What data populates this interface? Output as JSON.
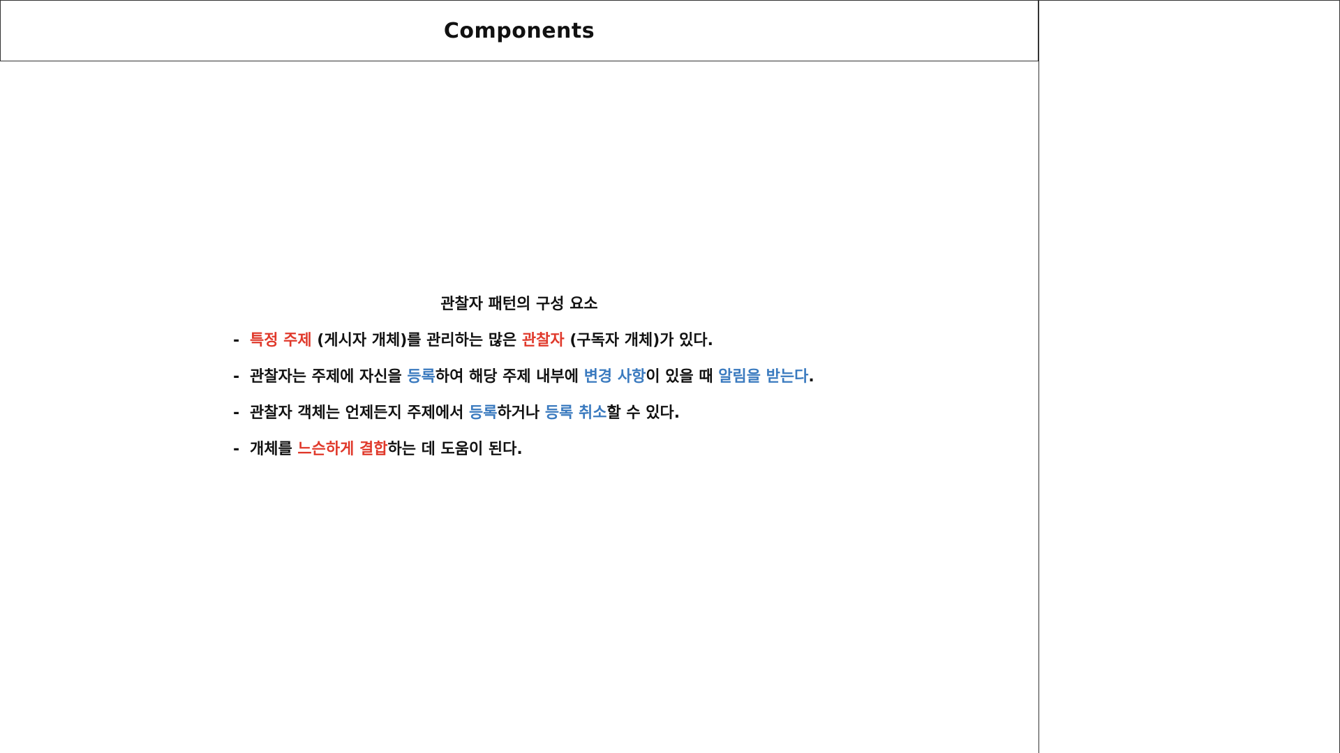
{
  "title": "Components",
  "heading": "관찰자 패턴의 구성 요소",
  "bullet_marker": "-",
  "colors": {
    "red": "#e0392b",
    "blue": "#3a7abf",
    "text": "#111111",
    "border": "#333333"
  },
  "bullets": [
    {
      "segments": [
        {
          "text": "특정 주제",
          "color": "red"
        },
        {
          "text": " (게시자 개체)를 관리하는 많은 ",
          "color": "text"
        },
        {
          "text": "관찰자",
          "color": "red"
        },
        {
          "text": " (구독자 개체)가 있다.",
          "color": "text"
        }
      ]
    },
    {
      "segments": [
        {
          "text": "관찰자는 주제에 자신을 ",
          "color": "text"
        },
        {
          "text": "등록",
          "color": "blue"
        },
        {
          "text": "하여 해당 주제 내부에 ",
          "color": "text"
        },
        {
          "text": "변경 사항",
          "color": "blue"
        },
        {
          "text": "이 있을 때 ",
          "color": "text"
        },
        {
          "text": "알림을 받는다",
          "color": "blue"
        },
        {
          "text": ".",
          "color": "text"
        }
      ]
    },
    {
      "segments": [
        {
          "text": "관찰자 객체는 언제든지 주제에서 ",
          "color": "text"
        },
        {
          "text": "등록",
          "color": "blue"
        },
        {
          "text": "하거나 ",
          "color": "text"
        },
        {
          "text": "등록 취소",
          "color": "blue"
        },
        {
          "text": "할 수 있다.",
          "color": "text"
        }
      ]
    },
    {
      "segments": [
        {
          "text": "개체를 ",
          "color": "text"
        },
        {
          "text": "느슨하게 결합",
          "color": "red"
        },
        {
          "text": "하는 데 도움이 된다.",
          "color": "text"
        }
      ]
    }
  ]
}
